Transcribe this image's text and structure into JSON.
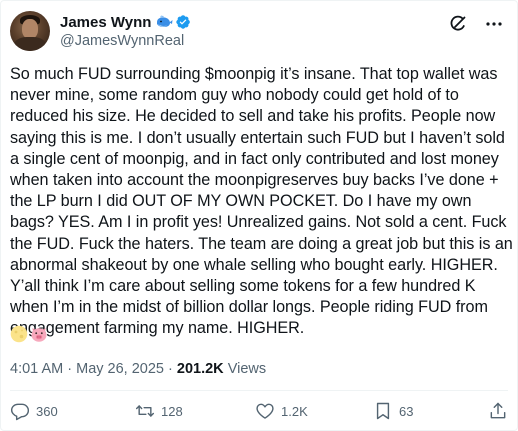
{
  "user": {
    "display_name": "James Wynn",
    "handle": "@JamesWynnReal",
    "name_emoji": "whale-icon",
    "verified": true
  },
  "header_icons": [
    "grok-icon",
    "more-icon"
  ],
  "tweet": {
    "text": "So much FUD surrounding $moonpig it’s insane. That top wallet was never mine, some random guy who nobody could get hold of to reduced his size. He decided to sell and take his profits. People now saying this is me. I don’t usually entertain such FUD but I haven’t sold a single cent of moonpig, and in fact only contributed and lost money when taken into account the moonpigreserves buy backs I’ve done + the LP burn I did OUT OF MY OWN POCKET. Do I have my own bags? YES. Am I in profit yes! Unrealized gains. Not sold a cent. Fuck the FUD. Fuck the haters. The team are doing a great job but this is an abnormal shakeout by one whale selling who bought early. HIGHER. Y’all think I’m care about selling some tokens for a few hundred K when I’m in the midst of billion dollar longs. People riding FUD from engagement farming my name. HIGHER.",
    "emojis": [
      "full-moon-face-emoji",
      "pig-face-emoji"
    ]
  },
  "meta": {
    "time": "4:01 AM",
    "separator": "·",
    "date": "May 26, 2025",
    "views_count": "201.2K",
    "views_label": "Views"
  },
  "actions": {
    "replies": "360",
    "reposts": "128",
    "likes": "1.2K",
    "bookmarks": "63"
  },
  "colors": {
    "text": "#0f1419",
    "secondary": "#536471",
    "verified": "#1d9bf0",
    "divider": "#eff3f4"
  }
}
